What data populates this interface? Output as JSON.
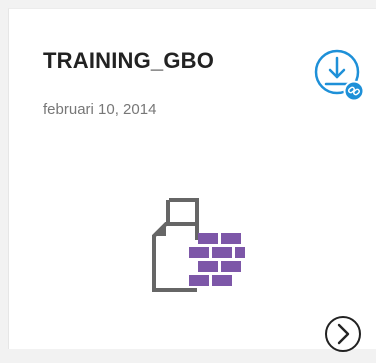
{
  "card": {
    "title": "TRAINING_GBO",
    "date": "februari 10, 2014",
    "icons": {
      "download": "download-link-icon",
      "file": "database-file-icon",
      "next": "chevron-right-circle-icon"
    },
    "colors": {
      "accent": "#1e90d8",
      "file_outline": "#666666",
      "bricks": "#7d57a8"
    }
  }
}
